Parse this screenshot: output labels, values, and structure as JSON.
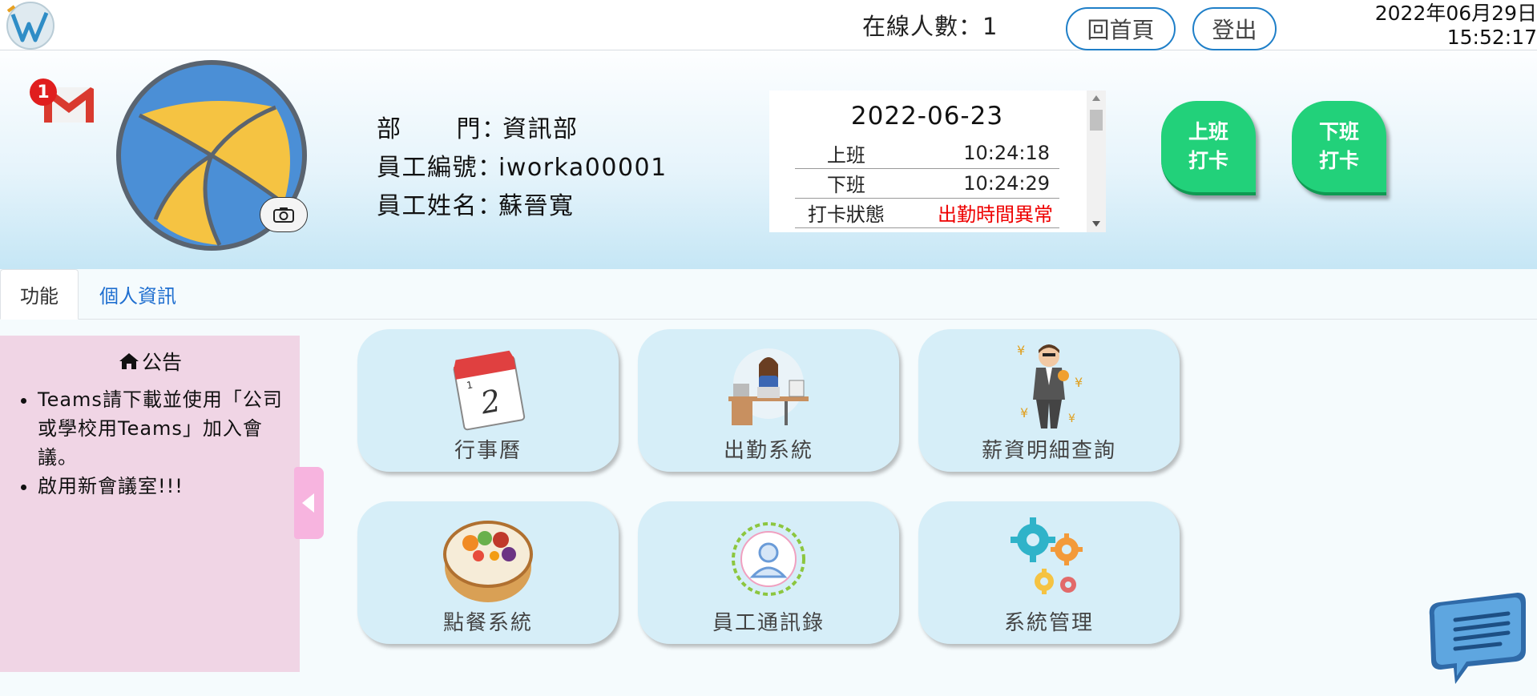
{
  "topbar": {
    "online_label": "在線人數：",
    "online_count": "1",
    "home_label": "回首頁",
    "logout_label": "登出",
    "date": "2022年06月29日",
    "time": "15:52:17"
  },
  "profile": {
    "mail_badge": "1",
    "department_label": "部門",
    "department_value": "資訊部",
    "employee_id_label": "員工編號",
    "employee_id_value": "iworka00001",
    "name_label": "員工姓名",
    "name_value": "蘇晉寬",
    "colon": "："
  },
  "punch": {
    "date": "2022-06-23",
    "rows": [
      {
        "label": "上班",
        "value": "10:24:18"
      },
      {
        "label": "下班",
        "value": "10:24:29"
      },
      {
        "label": "打卡狀態",
        "value": "出勤時間異常"
      }
    ],
    "clock_in": [
      "上班",
      "打卡"
    ],
    "clock_out": [
      "下班",
      "打卡"
    ]
  },
  "tabs": [
    {
      "label": "功能",
      "active": true
    },
    {
      "label": "個人資訊",
      "active": false
    }
  ],
  "notice": {
    "title": "公告",
    "items": [
      "Teams請下載並使用「公司或學校用Teams」加入會議。",
      "啟用新會議室!!!"
    ]
  },
  "tiles": [
    {
      "label": "行事曆",
      "icon": "calendar-icon"
    },
    {
      "label": "出勤系統",
      "icon": "office-worker-icon"
    },
    {
      "label": "薪資明細查詢",
      "icon": "salary-icon"
    },
    {
      "label": "點餐系統",
      "icon": "bento-icon"
    },
    {
      "label": "員工通訊錄",
      "icon": "contact-icon"
    },
    {
      "label": "系統管理",
      "icon": "gears-icon"
    }
  ],
  "colors": {
    "accent": "#1f7fc8",
    "clock_button": "#22d17a",
    "error": "#e00000",
    "notice_bg": "#f0d5e5",
    "tile_bg": "#d6eef8"
  }
}
